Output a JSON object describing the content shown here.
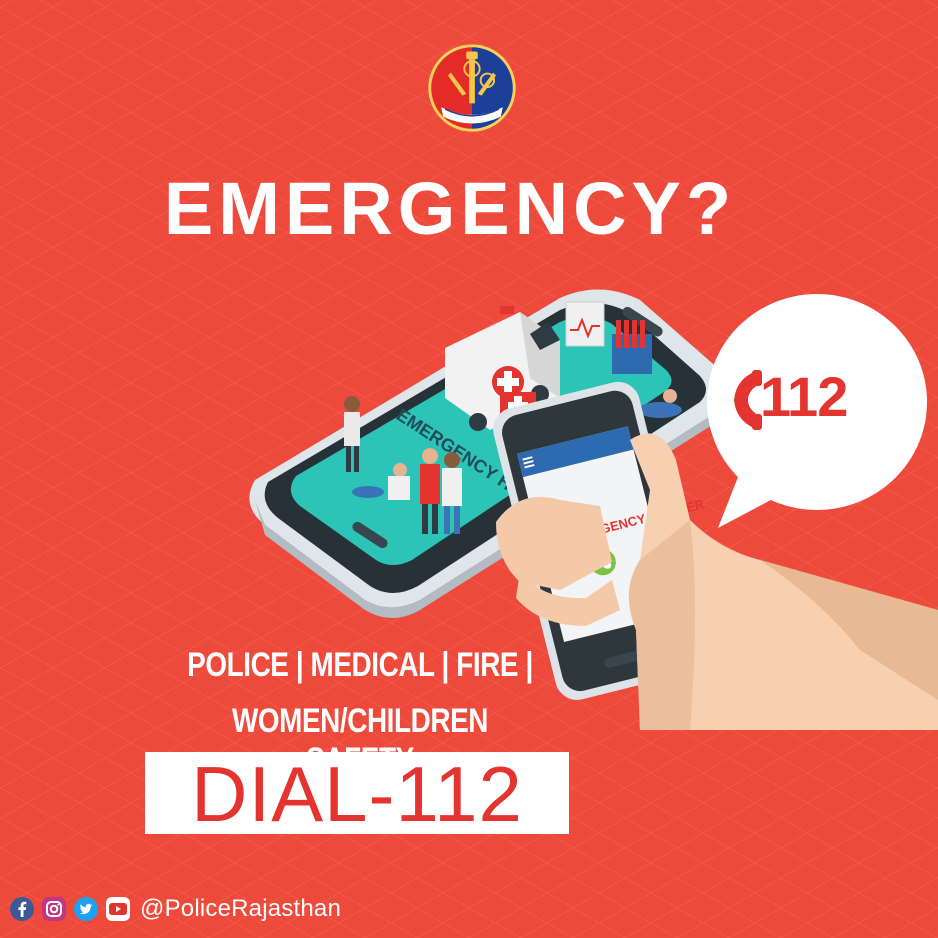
{
  "headline": "EMERGENCY?",
  "bubble": {
    "number": "112",
    "icon": "phone-icon"
  },
  "phone_screen": {
    "label": "EMERGENCY NUMBER",
    "icon": "call-icon"
  },
  "tablet_screen": {
    "label": "EMERGENCY HELP"
  },
  "services": {
    "line1": "POLICE | MEDICAL | FIRE |",
    "line2": "WOMEN/CHILDREN SAFETY"
  },
  "dial": "DIAL-112",
  "footer": {
    "handle": "@PoliceRajasthan",
    "icons": [
      "facebook-icon",
      "instagram-icon",
      "twitter-icon",
      "youtube-icon"
    ]
  },
  "colors": {
    "background": "#ee4a3c",
    "accent_red": "#e3342f",
    "teal_screen": "#2dc4b8",
    "white": "#ffffff"
  }
}
